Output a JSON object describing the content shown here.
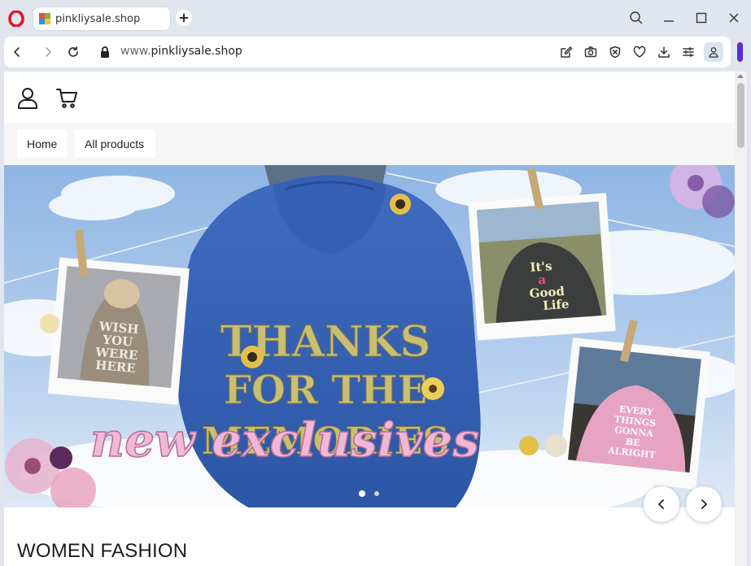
{
  "browser": {
    "tab_title": "pinkliysale.shop",
    "url_prefix": "www.",
    "url_domain": "pinkliysale.shop",
    "new_tab_symbol": "+",
    "accent_color": "#5b2bdc"
  },
  "site": {
    "nav": {
      "home_label": "Home",
      "all_products_label": "All products"
    },
    "hero": {
      "slide_count": 2,
      "active_slide": 1,
      "banner_text": "new exclusives",
      "hoodie_text_lines": [
        "THANKS",
        "FOR THE",
        "MEMORIES"
      ],
      "polaroid_left_text": [
        "WISH",
        "YOU",
        "WERE",
        "HERE"
      ],
      "polaroid_top_right_text": [
        "It's",
        "a",
        "Good",
        "Life"
      ],
      "polaroid_bottom_right_text": [
        "EVERY",
        "THINGS",
        "GONNA",
        "BE",
        "ALRIGHT"
      ]
    },
    "section_title": "WOMEN FASHION"
  },
  "icons": {
    "browser_logo": "opera-logo-icon",
    "back": "back-arrow-icon",
    "forward": "forward-arrow-icon",
    "reload": "reload-icon",
    "lock": "lock-icon",
    "account": "user-icon",
    "cart": "cart-icon"
  }
}
